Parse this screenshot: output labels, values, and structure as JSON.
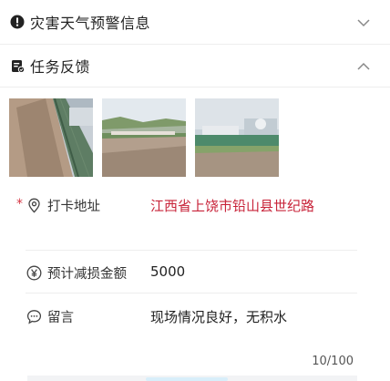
{
  "sections": {
    "warning": {
      "title": "灾害天气预警信息",
      "icon": "alert-circle-icon",
      "expanded": false
    },
    "feedback": {
      "title": "任务反馈",
      "icon": "task-form-icon",
      "expanded": true
    }
  },
  "photos": [
    {
      "name": "photo-1",
      "icon": "photo-thumbnail"
    },
    {
      "name": "photo-2",
      "icon": "photo-thumbnail"
    },
    {
      "name": "photo-3",
      "icon": "photo-thumbnail"
    }
  ],
  "fields": {
    "address": {
      "required_mark": "*",
      "icon": "location-pin-icon",
      "label": "打卡地址",
      "value": "江西省上饶市铅山县世纪路",
      "value_color": "#c8243a"
    },
    "amount": {
      "icon": "yen-circle-icon",
      "label": "预计减损金额",
      "value": "5000"
    },
    "message": {
      "icon": "chat-bubble-icon",
      "label": "留言",
      "value": "现场情况良好，无积水"
    }
  },
  "counter": "10/100",
  "colors": {
    "accent": "#c8243a",
    "divider": "#eeeeee"
  }
}
